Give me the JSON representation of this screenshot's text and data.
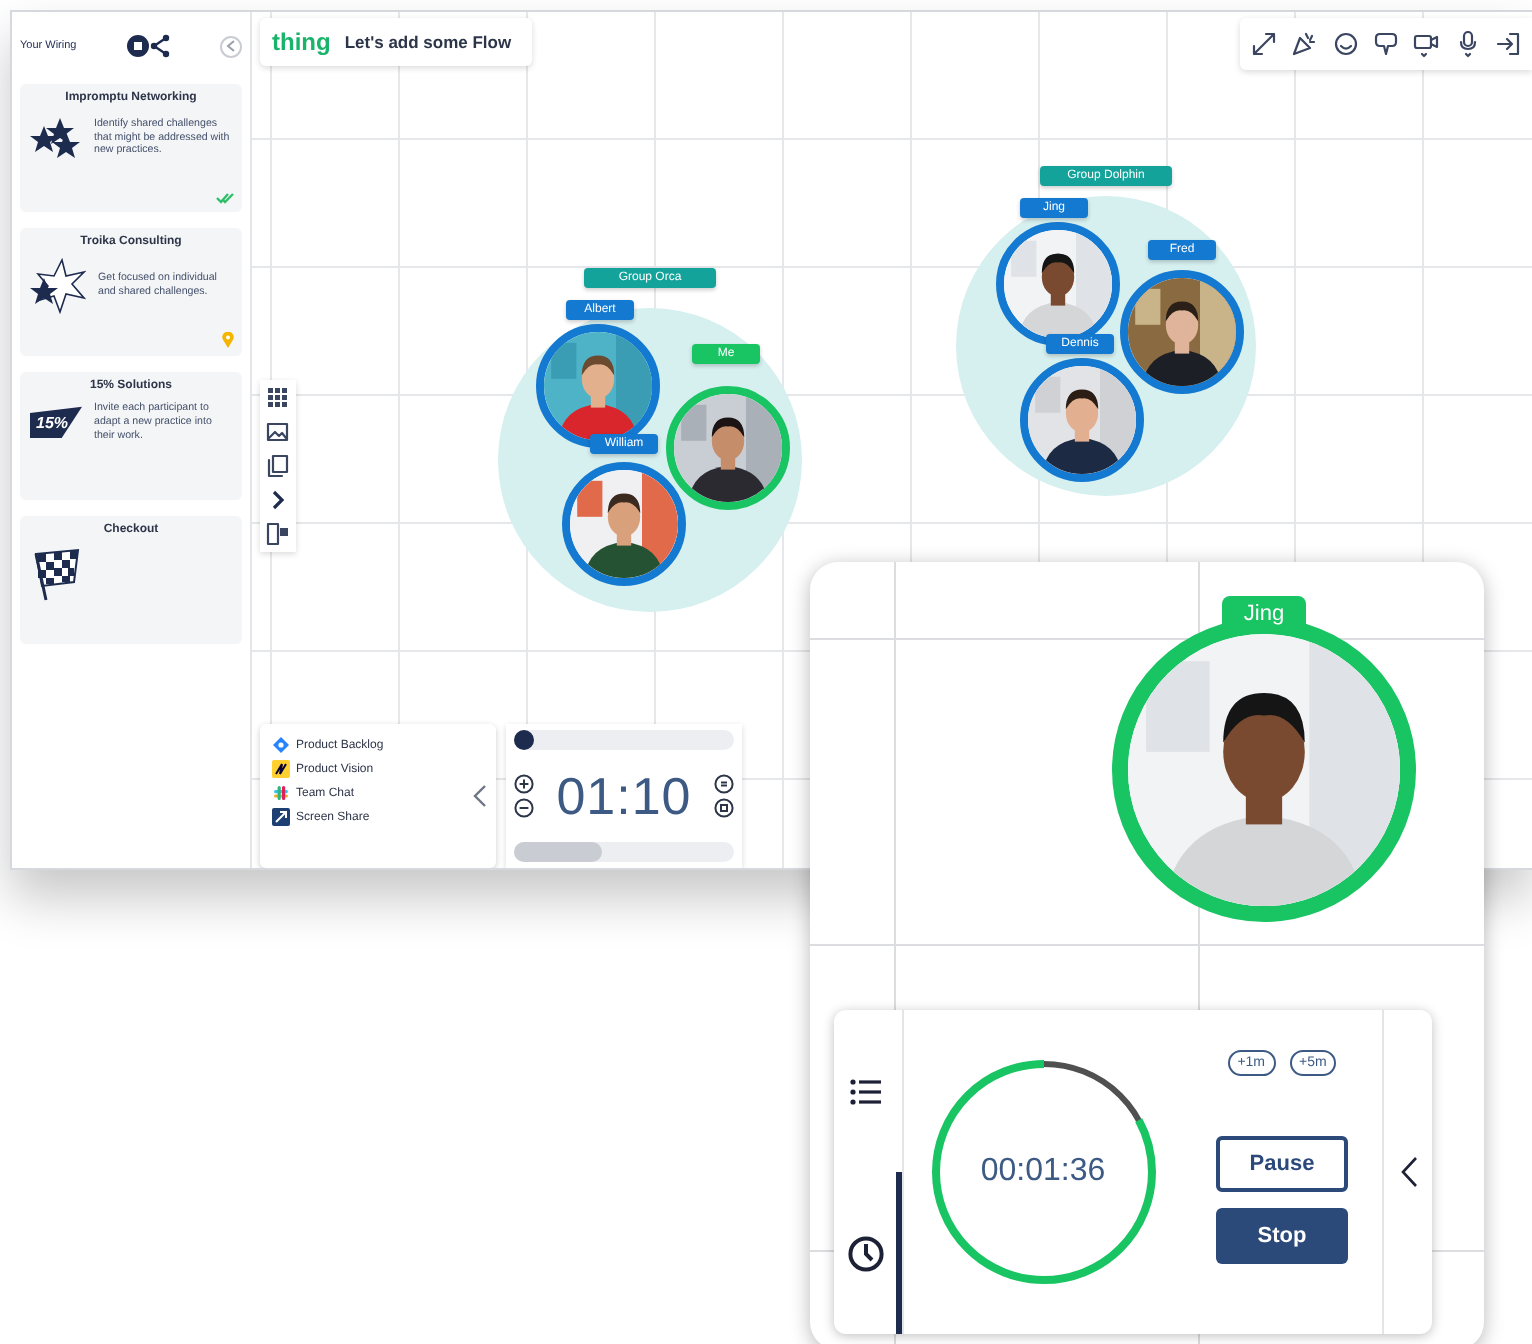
{
  "sidebar": {
    "title": "Your Wiring",
    "cards": [
      {
        "title": "Impromptu Networking",
        "kind": "stars",
        "description": "Identify shared challenges that might be addressed with new practices.",
        "completed": true,
        "current": false
      },
      {
        "title": "Troika Consulting",
        "kind": "burst",
        "description": "Get focused on individual and shared challenges.",
        "completed": false,
        "current": true
      },
      {
        "title": "15% Solutions",
        "kind": "pennant",
        "badge": "15%",
        "description": "Invite each participant to adapt a new practice into their work.",
        "completed": false,
        "current": false
      },
      {
        "title": "Checkout",
        "kind": "flag",
        "completed": false,
        "current": false
      }
    ]
  },
  "header": {
    "brand": "thing",
    "title": "Let's add some Flow"
  },
  "groups": [
    {
      "name": "Group Orca",
      "members": [
        {
          "name": "Albert",
          "color": "#1479d0"
        },
        {
          "name": "Me",
          "color": "#19c463"
        },
        {
          "name": "William",
          "color": "#1479d0"
        }
      ]
    },
    {
      "name": "Group Dolphin",
      "members": [
        {
          "name": "Jing",
          "color": "#1479d0"
        },
        {
          "name": "Fred",
          "color": "#1479d0"
        },
        {
          "name": "Dennis",
          "color": "#1479d0"
        }
      ]
    }
  ],
  "tools": [
    {
      "kind": "backlog",
      "label": "Product Backlog"
    },
    {
      "kind": "vision",
      "label": "Product Vision"
    },
    {
      "kind": "chat",
      "label": "Team Chat"
    },
    {
      "kind": "share",
      "label": "Screen Share"
    }
  ],
  "mini_timer": {
    "slider": {
      "level": 0
    },
    "time": "01:10",
    "progress": {
      "level": 0.4
    }
  },
  "spotlight": {
    "name": "Jing",
    "color": "#19c463"
  },
  "timer": {
    "tabs": [
      {
        "kind": "list",
        "selected": false
      },
      {
        "kind": "clock",
        "selected": true
      }
    ],
    "time": "00:01:36",
    "level": 0.83,
    "add_buttons": [
      "+1m",
      "+5m"
    ],
    "buttons": [
      {
        "kind": "outline",
        "label": "Pause"
      },
      {
        "kind": "primary",
        "label": "Stop"
      }
    ]
  }
}
